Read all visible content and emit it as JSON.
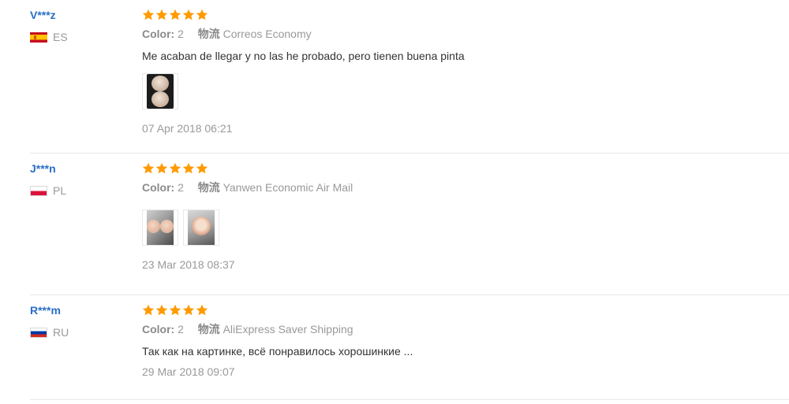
{
  "colors": {
    "username": "#2a6fc6",
    "star": "#ff9a00",
    "muted": "#999999",
    "divider": "#e8e8e8"
  },
  "icons": {
    "star": "star-icon",
    "flags": [
      "spain-flag-icon",
      "poland-flag-icon",
      "russia-flag-icon"
    ]
  },
  "reviews": [
    {
      "user": "V***z",
      "country": "ES",
      "rating": 5,
      "color_label": "Color:",
      "color_value": "2",
      "shipping_label": "物流",
      "shipping_value": "Correos Economy",
      "text": "Me acaban de llegar y no las he probado, pero tienen buena pinta",
      "image_count": 1,
      "date": "07 Apr 2018 06:21"
    },
    {
      "user": "J***n",
      "country": "PL",
      "rating": 5,
      "color_label": "Color:",
      "color_value": "2",
      "shipping_label": "物流",
      "shipping_value": "Yanwen Economic Air Mail",
      "text": "",
      "image_count": 2,
      "date": "23 Mar 2018 08:37"
    },
    {
      "user": "R***m",
      "country": "RU",
      "rating": 5,
      "color_label": "Color:",
      "color_value": "2",
      "shipping_label": "物流",
      "shipping_value": "AliExpress Saver Shipping",
      "text": "Так как на картинке, всё понравилось хорошинкие ...",
      "image_count": 0,
      "date": "29 Mar 2018 09:07"
    }
  ]
}
